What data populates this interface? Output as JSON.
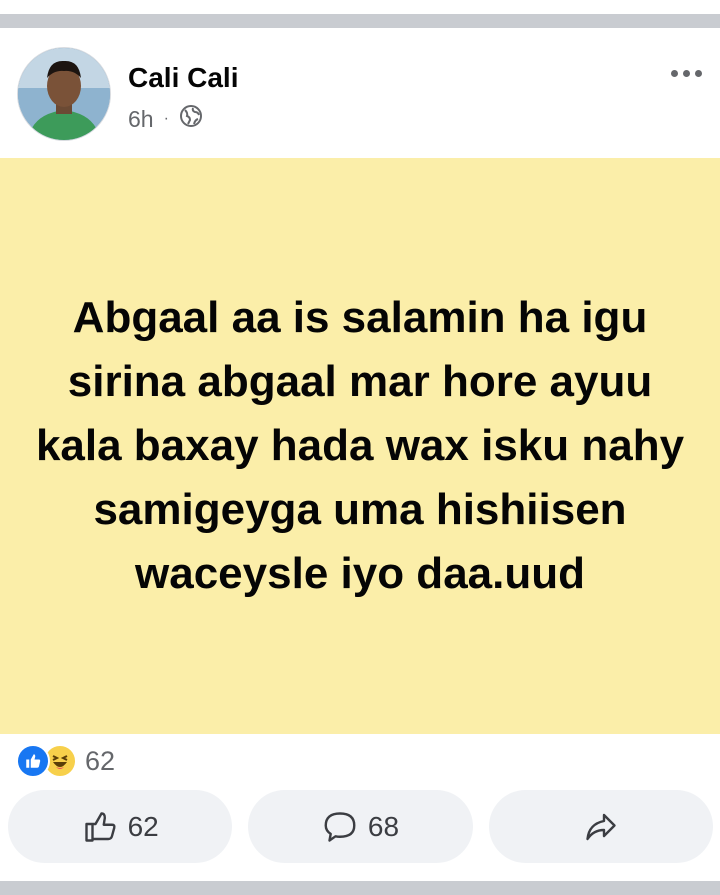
{
  "post": {
    "author": "Cali Cali",
    "time": "6h",
    "separator": "·",
    "privacy_icon": "globe-icon",
    "text": "Abgaal aa is salamin ha igu sirina abgaal mar hore ayuu kala baxay hada wax isku nahy samigeyga uma hishiisen waceysle iyo daa.uud",
    "background_color": "#fbeea9"
  },
  "reactions": {
    "icons": [
      "like-reaction-icon",
      "haha-reaction-icon"
    ],
    "count": "62"
  },
  "actions": {
    "like_count": "62",
    "comment_count": "68",
    "share_icon": "share-icon"
  }
}
